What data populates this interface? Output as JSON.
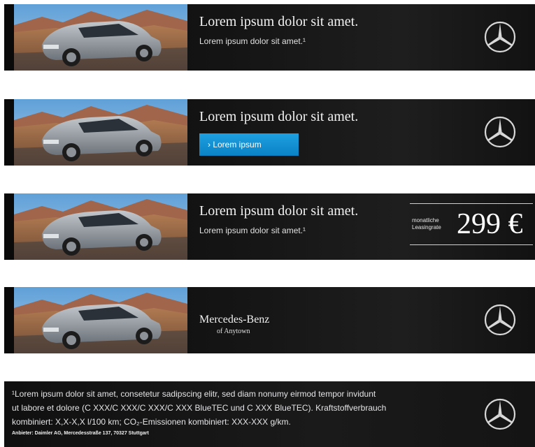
{
  "banners": [
    {
      "variant": "text",
      "headline": "Lorem ipsum dolor sit amet.",
      "subline": "Lorem ipsum dolor sit amet.¹",
      "logo_icon": "mercedes-star-icon"
    },
    {
      "variant": "cta",
      "headline": "Lorem ipsum dolor sit amet.",
      "cta_label": "› Lorem ipsum",
      "cta_color": "#0a82c6",
      "logo_icon": "mercedes-star-icon"
    },
    {
      "variant": "price",
      "headline": "Lorem ipsum dolor sit amet.",
      "subline": "Lorem ipsum dolor sit amet.¹",
      "price_label_line1": "monatliche",
      "price_label_line2": "Leasingrate",
      "price_value": "299 €"
    },
    {
      "variant": "dealer",
      "dealer_name": "Mercedes-Benz",
      "dealer_location": "of Anytown",
      "logo_icon": "mercedes-star-icon"
    }
  ],
  "footer": {
    "disclaimer_line1": "¹Lorem ipsum dolor sit amet, consetetur sadipscing elitr, sed diam nonumy eirmod tempor invidunt",
    "disclaimer_line2": "ut labore et dolore (C XXX/C XXX/C XXX/C XXX BlueTEC und C XXX BlueTEC). Kraftstoffverbrauch",
    "disclaimer_line3": "kombiniert: X,X-X,X l/100 km; CO₂-Emissionen kombiniert: XXX-XXX g/km.",
    "provider": "Anbieter: Daimler AG, Mercedesstraße 137, 70327 Stuttgart",
    "logo_icon": "mercedes-star-icon"
  },
  "colors": {
    "banner_background": "#151515",
    "cta_blue": "#0a82c6",
    "text_light": "#f2f2f2"
  }
}
